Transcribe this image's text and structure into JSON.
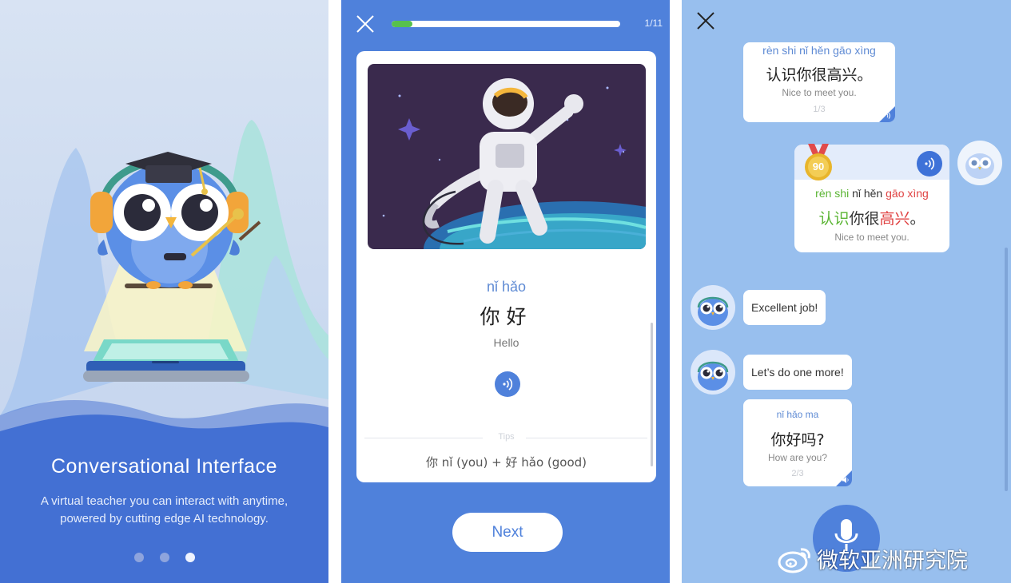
{
  "onboarding": {
    "title": "Conversational Interface",
    "subtitle_line1": "A virtual teacher you can interact with anytime,",
    "subtitle_line2": "powered by cutting edge AI technology.",
    "pagination": {
      "total": 3,
      "active": 3
    }
  },
  "lesson": {
    "progress_label": "1/11",
    "progress_fraction": 0.09,
    "word": {
      "pinyin": "nǐ hǎo",
      "hanzi": "你好",
      "english": "Hello"
    },
    "tips_label": "Tips",
    "breakdown": "你 nǐ (you) + 好 hǎo (good)",
    "next_label": "Next"
  },
  "chat": {
    "prompt_card": {
      "pinyin": "rèn shi nǐ hěn gāo xìng",
      "hanzi": "认识你很高兴。",
      "english": "Nice to meet you.",
      "counter": "1/3"
    },
    "user_answer": {
      "score": "90",
      "pinyin_parts": [
        {
          "text": "rèn shi",
          "color": "green"
        },
        {
          "text": " nǐ hěn ",
          "color": "dark"
        },
        {
          "text": "gāo xìng",
          "color": "red"
        }
      ],
      "hanzi_parts": [
        {
          "text": "认识",
          "color": "green"
        },
        {
          "text": "你很",
          "color": "dark"
        },
        {
          "text": "高兴",
          "color": "red"
        },
        {
          "text": "。",
          "color": "dark"
        }
      ],
      "english": "Nice to meet you."
    },
    "messages": [
      {
        "text": "Excellent job!"
      },
      {
        "text": "Let’s do one more!"
      }
    ],
    "next_card": {
      "pinyin": "nǐ hǎo ma",
      "hanzi": "你好吗?",
      "english": "How are you?",
      "counter": "2/3"
    }
  },
  "watermark": {
    "text": "微软亚洲研究院",
    "icon": "weibo-icon"
  },
  "colors": {
    "primary_blue": "#4f81db",
    "chat_bg": "#98bfee",
    "progress_green": "#57c14d",
    "correct_green": "#5bb534",
    "wrong_red": "#e04242",
    "score_gold": "#e8b52c"
  }
}
